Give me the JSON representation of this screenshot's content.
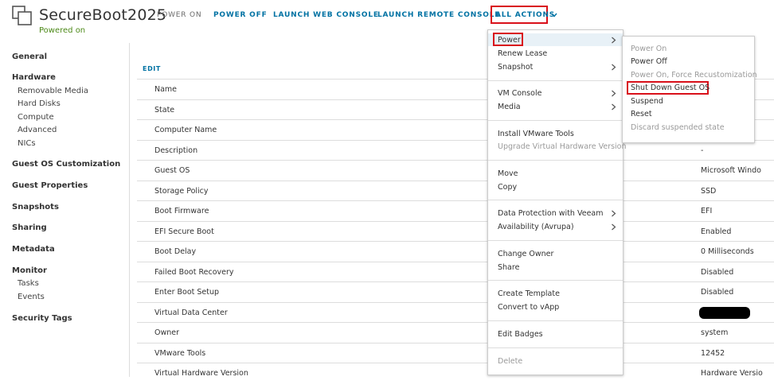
{
  "header": {
    "vm_name": "SecureBoot2025",
    "status": "Powered on",
    "actions": {
      "power_on": "POWER ON",
      "power_off": "POWER OFF",
      "launch_web_console": "LAUNCH WEB CONSOLE",
      "launch_remote_console": "LAUNCH REMOTE CONSOLE",
      "all_actions": "ALL ACTIONS"
    }
  },
  "sidebar": {
    "general": "General",
    "hardware": "Hardware",
    "hardware_items": [
      "Removable Media",
      "Hard Disks",
      "Compute",
      "Advanced",
      "NICs"
    ],
    "guest_os_customization": "Guest OS Customization",
    "guest_properties": "Guest Properties",
    "snapshots": "Snapshots",
    "sharing": "Sharing",
    "metadata": "Metadata",
    "monitor": "Monitor",
    "monitor_items": [
      "Tasks",
      "Events"
    ],
    "security_tags": "Security Tags"
  },
  "main": {
    "edit_label": "EDIT",
    "rows": [
      {
        "name": "Name",
        "value": ""
      },
      {
        "name": "State",
        "value": ""
      },
      {
        "name": "Computer Name",
        "value": ""
      },
      {
        "name": "Description",
        "value": "-"
      },
      {
        "name": "Guest OS",
        "value": "Microsoft Windo"
      },
      {
        "name": "Storage Policy",
        "value": "SSD"
      },
      {
        "name": "Boot Firmware",
        "value": "EFI"
      },
      {
        "name": "EFI Secure Boot",
        "value": "Enabled"
      },
      {
        "name": "Boot Delay",
        "value": "0 Milliseconds"
      },
      {
        "name": "Failed Boot Recovery",
        "value": "Disabled"
      },
      {
        "name": "Enter Boot Setup",
        "value": "Disabled"
      },
      {
        "name": "Virtual Data Center",
        "value": ""
      },
      {
        "name": "Owner",
        "value": "system"
      },
      {
        "name": "VMware Tools",
        "value": "12452"
      },
      {
        "name": "Virtual Hardware Version",
        "value": "Hardware Versio"
      }
    ]
  },
  "actions_menu": {
    "power": "Power",
    "renew_lease": "Renew Lease",
    "snapshot": "Snapshot",
    "vm_console": "VM Console",
    "media": "Media",
    "install_vmware_tools": "Install VMware Tools",
    "upgrade_virtual_hardware": "Upgrade Virtual Hardware Version",
    "move": "Move",
    "copy": "Copy",
    "data_protection": "Data Protection with Veeam",
    "availability": "Availability (Avrupa)",
    "change_owner": "Change Owner",
    "share": "Share",
    "create_template": "Create Template",
    "convert_to_vapp": "Convert to vApp",
    "edit_badges": "Edit Badges",
    "delete": "Delete"
  },
  "power_submenu": {
    "power_on": "Power On",
    "power_off": "Power Off",
    "power_on_force": "Power On, Force Recustomization",
    "shut_down": "Shut Down Guest OS",
    "suspend": "Suspend",
    "reset": "Reset",
    "discard_suspended": "Discard suspended state"
  },
  "colors": {
    "link_blue": "#0072a3",
    "status_green": "#4e8a1a",
    "highlight_red": "#d9101a"
  }
}
